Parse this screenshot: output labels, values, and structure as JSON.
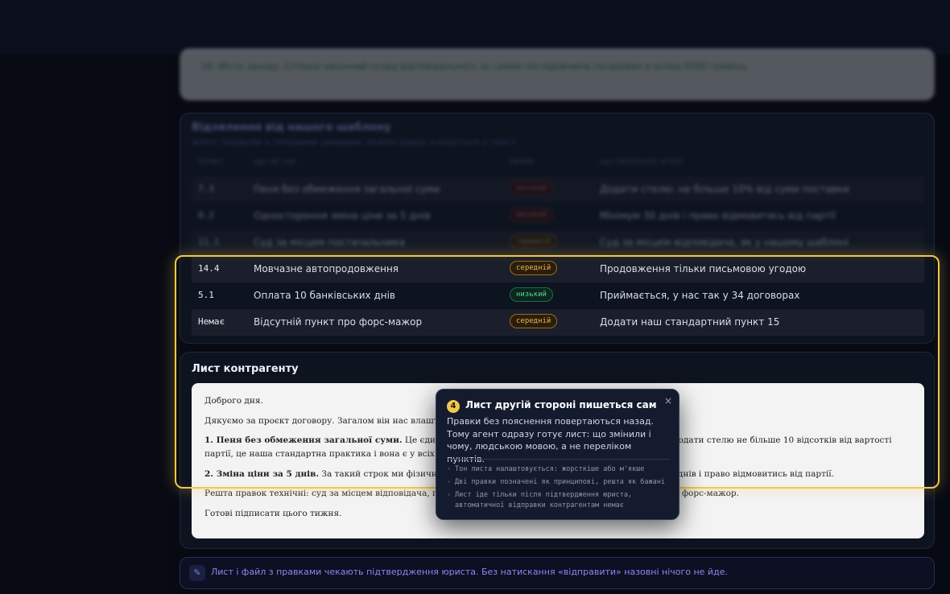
{
  "previous": {
    "line": "16. Місто заходу: Стільки законний склад відповідального за сумою послідовників посадових в оклад 5500 гривень"
  },
  "deviations": {
    "title": "Відхилення від нашого шаблону",
    "subtitle": "агент порівняв з типовими умовами, кожен рядок клікається у текст",
    "headers": [
      "ПУНКТ",
      "ЩО НЕ ТАК",
      "РИЗИК",
      "ЩО ПРОПОНУЄ АГЕНТ"
    ],
    "rows": [
      {
        "clause": "7.3",
        "issue": "Пеня без обмеження загальної суми",
        "risk": "високий",
        "level": "high",
        "proposal": "Додати стелю: не більше 10% від суми поставки"
      },
      {
        "clause": "9.2",
        "issue": "Одностороння зміна ціни за 5 днів",
        "risk": "високий",
        "level": "high",
        "proposal": "Мінімум 30 днів і право відмовитись від партії"
      },
      {
        "clause": "11.1",
        "issue": "Суд за місцем постачальника",
        "risk": "середній",
        "level": "mid",
        "proposal": "Суд за місцем відповідача, як у нашому шаблоні"
      },
      {
        "clause": "14.4",
        "issue": "Мовчазне автопродовження",
        "risk": "середній",
        "level": "mid",
        "proposal": "Продовження тільки письмовою угодою"
      },
      {
        "clause": "5.1",
        "issue": "Оплата 10 банківських днів",
        "risk": "низький",
        "level": "low",
        "proposal": "Приймається, у нас так у 34 договорах"
      },
      {
        "clause": "Немає",
        "issue": "Відсутній пункт про форс-мажор",
        "risk": "середній",
        "level": "mid",
        "proposal": "Додати наш стандартний пункт 15"
      }
    ]
  },
  "letter": {
    "title": "Лист контрагенту",
    "greeting": "Доброго дня.",
    "intro": "Дякуємо за проєкт договору. Загалом він нас влаштовує, повертаємо його з кількома правками.",
    "p1_bold": "1. Пеня без обмеження загальної суми.",
    "p1_text": " Це єдина умова, яку ми не можемо прийняти. Пропонуємо додати стелю не більше 10 відсотків від вартості партії, це наша стандартна практика і вона є у всіх наших чинних договорах.",
    "p2_bold": "2. Зміна ціни за 5 днів.",
    "p2_text": " За такий строк ми фізично не встигаємо перебудувати закупівлю. Просимо 30 днів і право відмовитись від партії.",
    "p3": "Решта правок технічні: суд за місцем відповідача, продовження тільки письмово, стандартний пункт про форс-мажор.",
    "closing": "Готові підписати цього тижня."
  },
  "tooltip": {
    "step": "4",
    "title": "Лист другій стороні пишеться сам",
    "body": "Правки без пояснення повертаються назад. Тому агент одразу готує лист: що змінили і чому, людською мовою, а не переліком пунктів.",
    "bullets": [
      "Тон листа налаштовується: жорсткіше або м'якше",
      "Дві правки позначені як принципові, решта як бажані",
      "Лист іде тільки після підтвердження юриста, автоматичної відправки контрагентам немає"
    ],
    "close": "×"
  },
  "notice": {
    "icon": "✎",
    "text": "Лист і файл з правками чекають підтвердження юриста. Без натискання «відправити» назовні нічого не йде."
  }
}
